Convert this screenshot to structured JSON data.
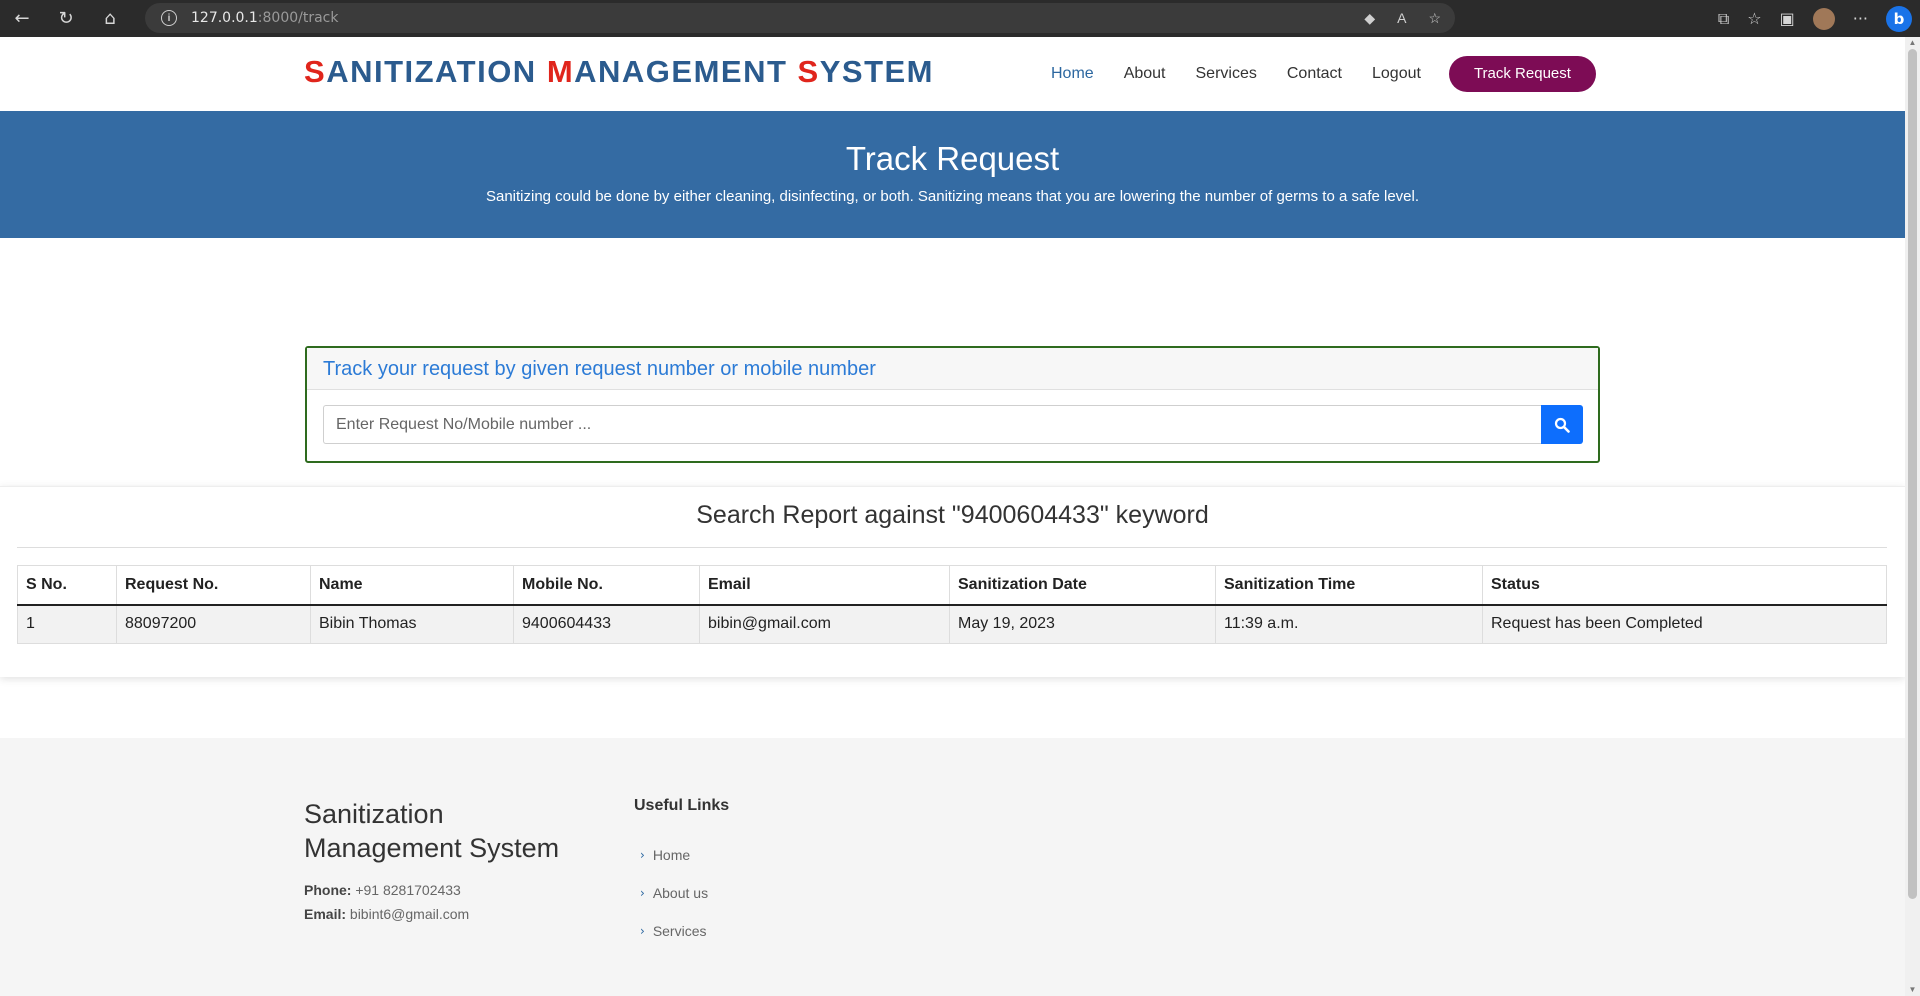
{
  "browser": {
    "url_host": "127.0.0.1",
    "url_path": ":8000/track"
  },
  "header": {
    "logo": {
      "part1_initial": "S",
      "part1_rest": "ANITIZATION ",
      "part2_initial": "M",
      "part2_rest": "ANAGEMENT ",
      "part3_initial": "S",
      "part3_rest": "YSTEM"
    },
    "nav": {
      "home": "Home",
      "about": "About",
      "services": "Services",
      "contact": "Contact",
      "logout": "Logout",
      "track": "Track Request"
    }
  },
  "banner": {
    "title": "Track Request",
    "subtitle": "Sanitizing could be done by either cleaning, disinfecting, or both. Sanitizing means that you are lowering the number of germs to a safe level."
  },
  "track": {
    "heading": "Track your request by given request number or mobile number",
    "placeholder": "Enter Request No/Mobile number ..."
  },
  "report": {
    "title": "Search Report against \"9400604433\" keyword",
    "columns": [
      "S No.",
      "Request No.",
      "Name",
      "Mobile No.",
      "Email",
      "Sanitization Date",
      "Sanitization Time",
      "Status"
    ],
    "rows": [
      [
        "1",
        "88097200",
        "Bibin Thomas",
        "9400604433",
        "bibin@gmail.com",
        "May 19, 2023",
        "11:39 a.m.",
        "Request has been Completed"
      ]
    ]
  },
  "footer": {
    "brand_line1": "Sanitization",
    "brand_line2": "Management System",
    "phone_label": "Phone:",
    "phone": "+91 8281702433",
    "email_label": "Email:",
    "email": "bibint6@gmail.com",
    "links_title": "Useful Links",
    "links": [
      "Home",
      "About us",
      "Services"
    ]
  },
  "colors": {
    "brand_blue": "#346ba3",
    "logo_red": "#e0251c",
    "track_button": "#7d0c55",
    "card_border": "#2e6b1e",
    "search_button": "#0d6efd"
  }
}
